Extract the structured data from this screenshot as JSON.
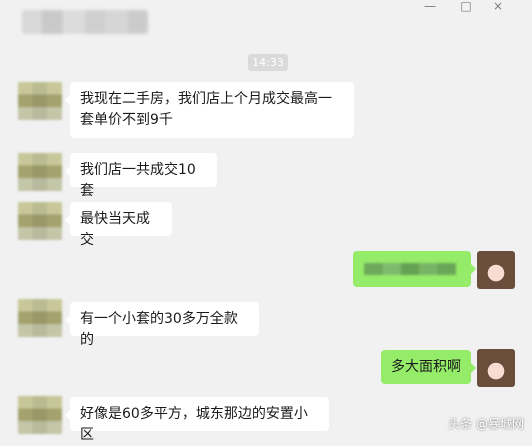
{
  "chat": {
    "timestamp": "14:33",
    "messages": [
      {
        "side": "left",
        "text": "我现在二手房，我们店上个月成交最高一套单价不到9千"
      },
      {
        "side": "left",
        "text": "我们店一共成交10套"
      },
      {
        "side": "left",
        "text": "最快当天成交"
      },
      {
        "side": "right",
        "text": "",
        "blurred": true
      },
      {
        "side": "left",
        "text": "有一个小套的30多万全款的"
      },
      {
        "side": "right",
        "text": "多大面积啊"
      },
      {
        "side": "left",
        "text": "好像是60多平方，城东那边的安置小区"
      }
    ]
  },
  "window_controls": {
    "minimize": "—",
    "maximize": "□",
    "close": "×"
  },
  "watermark": "头条 @暴城网",
  "colors": {
    "background": "#f1f1f1",
    "incoming_bubble": "#ffffff",
    "outgoing_bubble": "#95ec69"
  }
}
